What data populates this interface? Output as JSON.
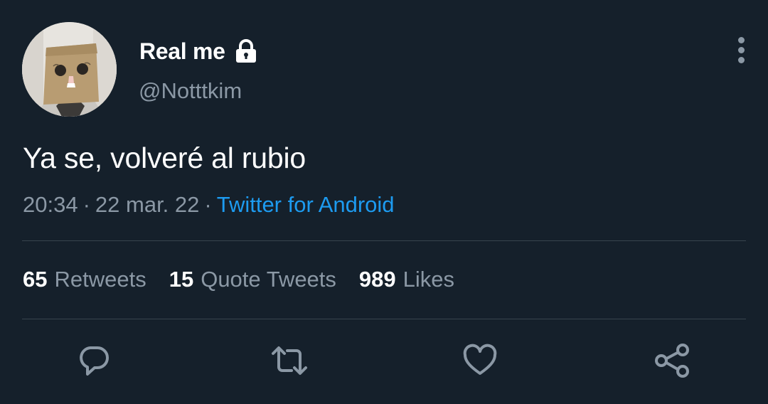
{
  "tweet": {
    "display_name": "Real me",
    "handle": "@Notttkim",
    "text": "Ya se, volveré al rubio",
    "time": "20:34",
    "date": "22 mar. 22",
    "separator": "·",
    "source": "Twitter for Android"
  },
  "stats": {
    "retweets_count": "65",
    "retweets_label": "Retweets",
    "quotes_count": "15",
    "quotes_label": "Quote Tweets",
    "likes_count": "989",
    "likes_label": "Likes"
  },
  "icons": {
    "lock": "lock-icon",
    "more": "more-vertical-icon",
    "reply": "reply-icon",
    "retweet": "retweet-icon",
    "like": "heart-icon",
    "share": "share-icon"
  },
  "colors": {
    "background": "#15202b",
    "primary_text": "#ffffff",
    "secondary_text": "#8b98a5",
    "link": "#1d9bf0",
    "divider": "#38444d"
  }
}
